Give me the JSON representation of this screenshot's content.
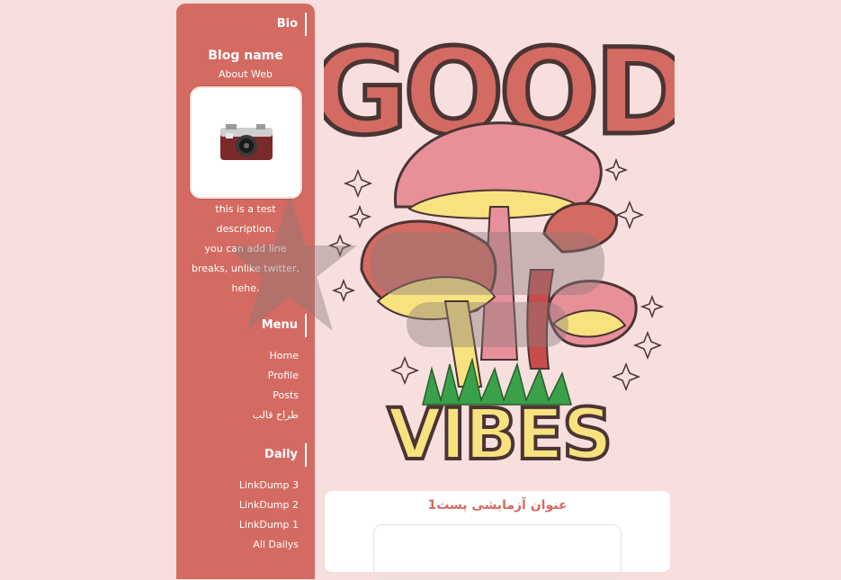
{
  "sidebar": {
    "bio_heading": "Bio",
    "blog_name": "Blog name",
    "about": "About Web",
    "description_lines": [
      "this is a test",
      "description.",
      "you can add line",
      "breaks, unlike twitter,",
      "hehe."
    ],
    "menu_heading": "Menu",
    "menu_items": [
      "Home",
      "Profile",
      "Posts",
      "طراح قالب"
    ],
    "daily_heading": "Daily",
    "daily_items": [
      "LinkDump 3",
      "LinkDump 2",
      "LinkDump 1",
      "All Dailys"
    ]
  },
  "hero": {
    "top_word": "GOOD",
    "bottom_word": "VIBES"
  },
  "post": {
    "title": "عنوان آزمایشی پست1"
  },
  "colors": {
    "background": "#f7dfde",
    "sidebar": "#d46b62",
    "accent_yellow": "#f7e27f",
    "accent_pink": "#e8909a"
  }
}
